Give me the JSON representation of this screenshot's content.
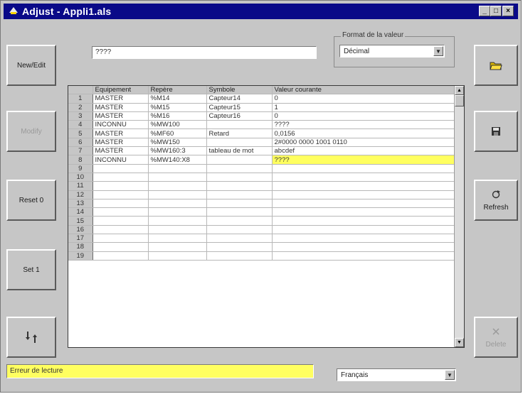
{
  "window": {
    "title": "Adjust - Appli1.als"
  },
  "buttons": {
    "new_edit": "New/Edit",
    "modify": "Modify",
    "reset": "Reset 0",
    "set": "Set 1",
    "refresh": "Refresh",
    "delete": "Delete"
  },
  "value_input": {
    "value": "????"
  },
  "format": {
    "label": "Format de la valeur",
    "selected": "Décimal"
  },
  "table": {
    "headers": [
      "Equipement",
      "Repère",
      "Symbole",
      "Valeur courante"
    ],
    "rows": [
      {
        "n": "1",
        "equip": "MASTER",
        "repere": "%M14",
        "symbole": "Capteur14",
        "valeur": "0"
      },
      {
        "n": "2",
        "equip": "MASTER",
        "repere": "%M15",
        "symbole": "Capteur15",
        "valeur": "1"
      },
      {
        "n": "3",
        "equip": "MASTER",
        "repere": "%M16",
        "symbole": "Capteur16",
        "valeur": "0"
      },
      {
        "n": "4",
        "equip": "INCONNU",
        "repere": "%MW100",
        "symbole": "",
        "valeur": "????"
      },
      {
        "n": "5",
        "equip": "MASTER",
        "repere": "%MF60",
        "symbole": "Retard",
        "valeur": "0,0156"
      },
      {
        "n": "6",
        "equip": "MASTER",
        "repere": "%MW150",
        "symbole": "",
        "valeur": "2#0000 0000 1001 0110"
      },
      {
        "n": "7",
        "equip": "MASTER",
        "repere": "%MW160:3",
        "symbole": "tableau de mot",
        "valeur": "abcdef"
      },
      {
        "n": "8",
        "equip": "INCONNU",
        "repere": "%MW140:X8",
        "symbole": "",
        "valeur": "????"
      },
      {
        "n": "9",
        "equip": "",
        "repere": "",
        "symbole": "",
        "valeur": ""
      },
      {
        "n": "10",
        "equip": "",
        "repere": "",
        "symbole": "",
        "valeur": ""
      },
      {
        "n": "11",
        "equip": "",
        "repere": "",
        "symbole": "",
        "valeur": ""
      },
      {
        "n": "12",
        "equip": "",
        "repere": "",
        "symbole": "",
        "valeur": ""
      },
      {
        "n": "13",
        "equip": "",
        "repere": "",
        "symbole": "",
        "valeur": ""
      },
      {
        "n": "14",
        "equip": "",
        "repere": "",
        "symbole": "",
        "valeur": ""
      },
      {
        "n": "15",
        "equip": "",
        "repere": "",
        "symbole": "",
        "valeur": ""
      },
      {
        "n": "16",
        "equip": "",
        "repere": "",
        "symbole": "",
        "valeur": ""
      },
      {
        "n": "17",
        "equip": "",
        "repere": "",
        "symbole": "",
        "valeur": ""
      },
      {
        "n": "18",
        "equip": "",
        "repere": "",
        "symbole": "",
        "valeur": ""
      },
      {
        "n": "19",
        "equip": "",
        "repere": "",
        "symbole": "",
        "valeur": ""
      }
    ],
    "selected_row": 8
  },
  "status": {
    "message": "Erreur de lecture"
  },
  "language": {
    "selected": "Français"
  },
  "colors": {
    "titlebar": "#0a0a88",
    "highlight": "#ffff60",
    "face": "#c6c6c6"
  },
  "icons": [
    "folder-open-icon",
    "floppy-save-icon",
    "refresh-icon",
    "delete-x-icon",
    "swap-arrows-icon"
  ]
}
